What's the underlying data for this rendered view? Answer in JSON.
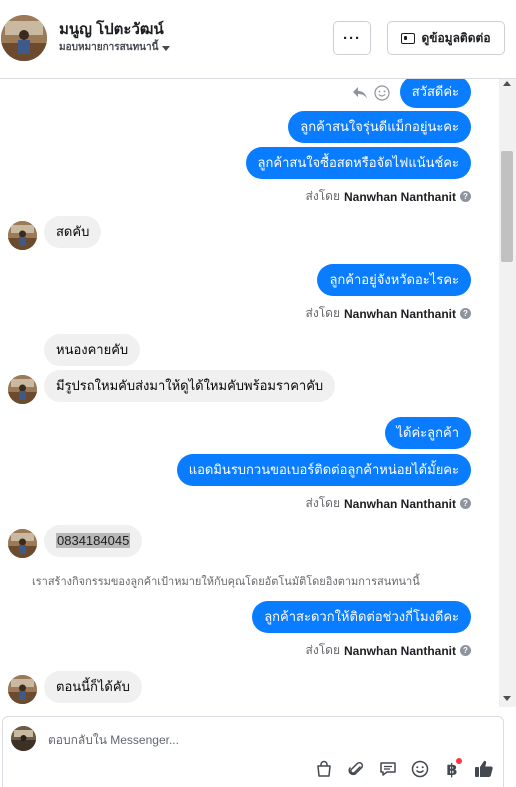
{
  "header": {
    "contact_name": "มนูญ โปตะวัฒน์",
    "assign_label": "มอบหมายการสนทนานี้",
    "more_label": "···",
    "contact_info_label": "ดูข้อมูลติดต่อ"
  },
  "messages": [
    {
      "dir": "out",
      "text": "สวัสดีค่ะ"
    },
    {
      "dir": "out",
      "text": "ลูกค้าสนใจรุ่นดีแม็กอยู่นะคะ"
    },
    {
      "dir": "out",
      "text": "ลูกค้าสนใจซื้อสดหรือจัดไฟแน้นช์คะ"
    },
    {
      "dir": "in",
      "text": "สดคับ"
    },
    {
      "dir": "out",
      "text": "ลูกค้าอยู่จังหวัดอะไรคะ"
    },
    {
      "dir": "in",
      "text": "หนองคายคับ"
    },
    {
      "dir": "in",
      "text": "มีรูปรถใหมคับส่งมาให้ดูได้ใหมคับพร้อมราคาคับ"
    },
    {
      "dir": "out",
      "text": "ได้ค่ะลูกค้า"
    },
    {
      "dir": "out",
      "text": "แอดมินรบกวนขอเบอร์ติดต่อลูกค้าหน่อยได้มั้ยคะ"
    },
    {
      "dir": "in",
      "text": "0834184045"
    },
    {
      "dir": "out",
      "text": "ลูกค้าสะดวกให้ติดต่อช่วงกี่โมงดีคะ"
    },
    {
      "dir": "in",
      "text": "ตอนนี้ก็ได้คับ"
    }
  ],
  "sent_by": {
    "prefix": "ส่งโดย",
    "name": "Nanwhan Nanthanit",
    "help_glyph": "?"
  },
  "system_note": "เราสร้างกิจกรรมของลูกค้าเป้าหมายให้กับคุณโดยอัตโนมัติโดยอิงตามการสนทนานี้",
  "composer": {
    "placeholder": "ตอบกลับใน Messenger...",
    "tools": [
      "bag-icon",
      "paperclip-icon",
      "chat-bubble-icon",
      "smiley-icon",
      "baht-icon",
      "thumbs-up-icon"
    ],
    "baht_glyph": "฿"
  },
  "colors": {
    "outgoing_bubble": "#0a7cff",
    "incoming_bubble": "#f0f0f0",
    "notification_dot": "#fa383e"
  }
}
